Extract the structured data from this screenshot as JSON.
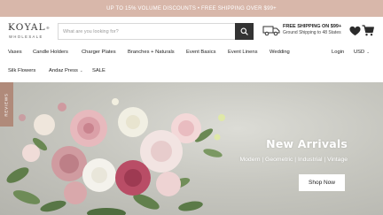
{
  "announcement": "UP TO 15% VOLUME DISCOUNTS • FREE SHIPPING OVER $99+",
  "logo": {
    "name": "KOYAL",
    "trademark": "®",
    "subtitle": "WHOLESALE"
  },
  "search": {
    "placeholder": "What are you looking for?",
    "value": ""
  },
  "shipping": {
    "title": "FREE SHIPPING ON $99+",
    "subtitle": "Ground Shipping to 48 States"
  },
  "nav": {
    "row1": [
      "Vases",
      "Candle Holders",
      "Charger Plates",
      "Branches + Naturals",
      "Event Basics",
      "Event Linens",
      "Wedding"
    ],
    "row2": [
      "Silk Flowers",
      "Andaz Press",
      "SALE"
    ],
    "login": "Login",
    "currency": "USD"
  },
  "hero": {
    "title": "New Arrivals",
    "subtitle": "Modern | Geometric | Industrial | Vintage",
    "button": "Shop Now"
  },
  "reviews_tab": "REVIEWS",
  "colors": {
    "announcement_bg": "#d8b7aa",
    "search_button": "#333333",
    "reviews_tab": "#b08a7a"
  },
  "icons": [
    "search-icon",
    "truck-icon",
    "heart-icon",
    "cart-icon",
    "chevron-down-icon"
  ]
}
